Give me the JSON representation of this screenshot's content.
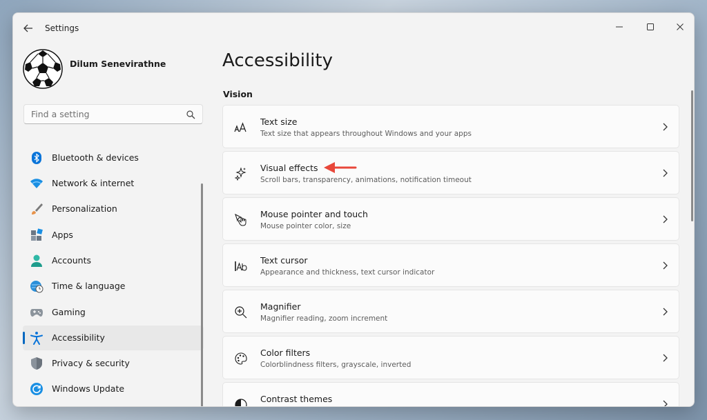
{
  "window": {
    "title": "Settings"
  },
  "profile": {
    "name": "Dilum Senevirathne"
  },
  "search": {
    "placeholder": "Find a setting"
  },
  "sidebar": {
    "items": [
      {
        "label": "Bluetooth & devices",
        "icon": "bluetooth-icon"
      },
      {
        "label": "Network & internet",
        "icon": "wifi-icon"
      },
      {
        "label": "Personalization",
        "icon": "brush-icon"
      },
      {
        "label": "Apps",
        "icon": "apps-icon"
      },
      {
        "label": "Accounts",
        "icon": "person-icon"
      },
      {
        "label": "Time & language",
        "icon": "globe-clock-icon"
      },
      {
        "label": "Gaming",
        "icon": "gamepad-icon"
      },
      {
        "label": "Accessibility",
        "icon": "accessibility-icon",
        "selected": true
      },
      {
        "label": "Privacy & security",
        "icon": "shield-icon"
      },
      {
        "label": "Windows Update",
        "icon": "update-icon"
      }
    ]
  },
  "main": {
    "title": "Accessibility",
    "section": "Vision",
    "cards": [
      {
        "title": "Text size",
        "desc": "Text size that appears throughout Windows and your apps",
        "icon": "text-size-icon"
      },
      {
        "title": "Visual effects",
        "desc": "Scroll bars, transparency, animations, notification timeout",
        "icon": "sparkle-icon"
      },
      {
        "title": "Mouse pointer and touch",
        "desc": "Mouse pointer color, size",
        "icon": "mouse-pointer-icon"
      },
      {
        "title": "Text cursor",
        "desc": "Appearance and thickness, text cursor indicator",
        "icon": "text-cursor-icon"
      },
      {
        "title": "Magnifier",
        "desc": "Magnifier reading, zoom increment",
        "icon": "magnifier-icon"
      },
      {
        "title": "Color filters",
        "desc": "Colorblindness filters, grayscale, inverted",
        "icon": "palette-icon"
      },
      {
        "title": "Contrast themes",
        "desc": "",
        "icon": "contrast-icon"
      }
    ]
  },
  "colors": {
    "accent": "#0067c0",
    "annotation_arrow": "#e8473a"
  }
}
